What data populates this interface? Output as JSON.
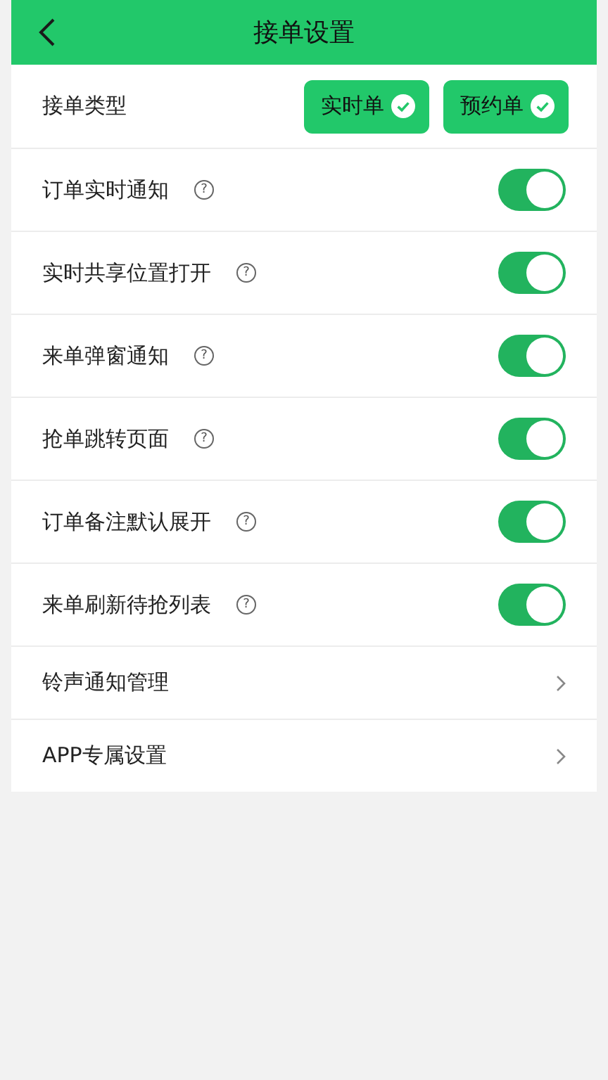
{
  "header": {
    "title": "接单设置"
  },
  "order_type": {
    "label": "接单类型",
    "options": [
      {
        "label": "实时单",
        "selected": true
      },
      {
        "label": "预约单",
        "selected": true
      }
    ]
  },
  "settings": [
    {
      "kind": "toggle",
      "label": "订单实时通知",
      "help": "?",
      "on": true
    },
    {
      "kind": "toggle",
      "label": "实时共享位置打开",
      "help": "?",
      "on": true
    },
    {
      "kind": "toggle",
      "label": "来单弹窗通知",
      "help": "?",
      "on": true
    },
    {
      "kind": "toggle",
      "label": "抢单跳转页面",
      "help": "?",
      "on": true
    },
    {
      "kind": "toggle",
      "label": "订单备注默认展开",
      "help": "?",
      "on": true
    },
    {
      "kind": "toggle",
      "label": "来单刷新待抢列表",
      "help": "?",
      "on": true
    },
    {
      "kind": "link",
      "label": "铃声通知管理"
    },
    {
      "kind": "link",
      "label": "APP专属设置"
    }
  ]
}
